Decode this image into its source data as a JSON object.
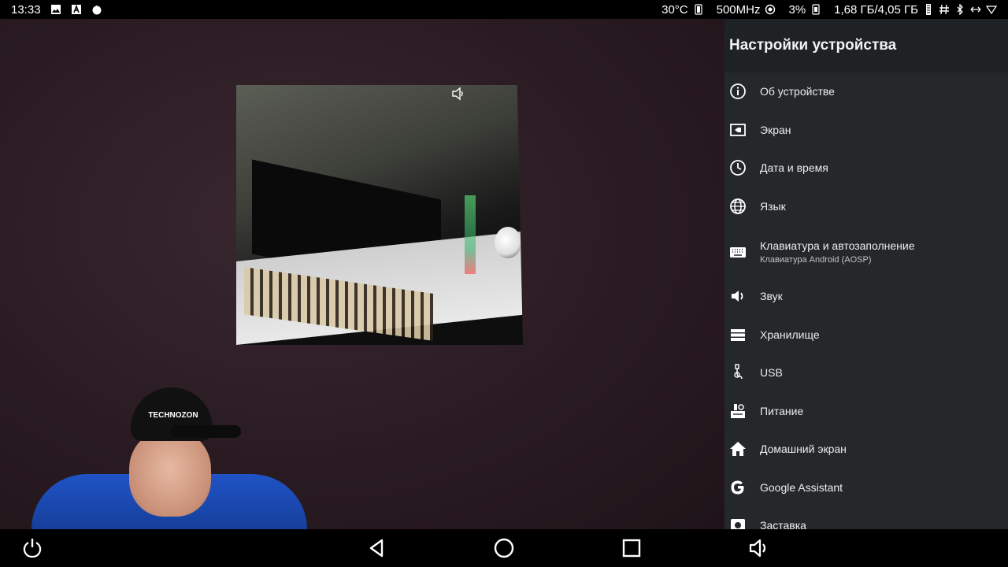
{
  "status_bar": {
    "time": "13:33",
    "temperature": "30°C",
    "cpu_freq": "500MHz",
    "cpu_load": "3%",
    "memory": "1,68 ГБ/4,05 ГБ",
    "icons": [
      "image-icon",
      "a-icon",
      "fire-icon",
      "thermometer-icon",
      "chip-icon",
      "sim-icon",
      "memory-icon",
      "hash-icon",
      "bluetooth-icon",
      "arrows-icon",
      "wifi-icon"
    ]
  },
  "preview": {
    "cap_text": "TECHNOZON"
  },
  "settings": {
    "title": "Настройки устройства",
    "items": [
      {
        "icon": "info-icon",
        "label": "Об устройстве"
      },
      {
        "icon": "screen-icon",
        "label": "Экран"
      },
      {
        "icon": "clock-icon",
        "label": "Дата и время"
      },
      {
        "icon": "globe-icon",
        "label": "Язык"
      },
      {
        "icon": "keyboard-icon",
        "label": "Клавиатура и автозаполнение",
        "sub": "Клавиатура Android (AOSP)"
      },
      {
        "icon": "volume-icon",
        "label": "Звук"
      },
      {
        "icon": "storage-icon",
        "label": "Хранилище"
      },
      {
        "icon": "usb-icon",
        "label": "USB"
      },
      {
        "icon": "power-settings-icon",
        "label": "Питание"
      },
      {
        "icon": "home-icon",
        "label": "Домашний экран"
      },
      {
        "icon": "google-icon",
        "label": "Google Assistant"
      },
      {
        "icon": "screensaver-icon",
        "label": "Заставка"
      }
    ]
  },
  "nav_bar": {
    "buttons": [
      "power-icon",
      "back-icon",
      "home-nav-icon",
      "recents-icon",
      "volume-nav-icon"
    ]
  },
  "colors": {
    "panel_bg": "#25282b",
    "header_bg": "#1f2224",
    "status_bg": "#000000"
  }
}
